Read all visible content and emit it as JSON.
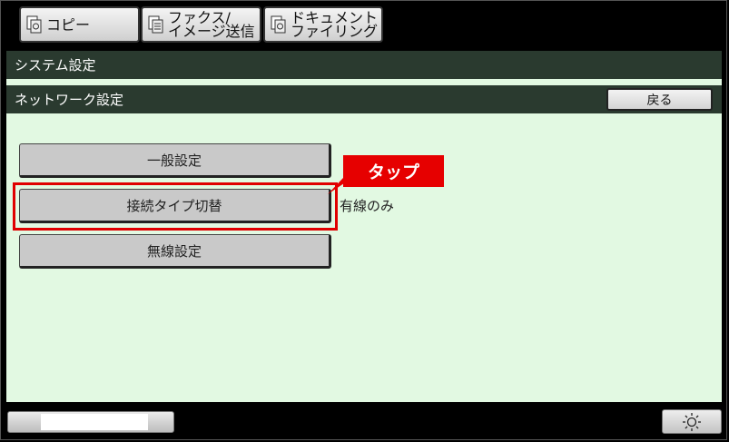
{
  "top_tabs": [
    {
      "label": "コピー"
    },
    {
      "label": "ファクス/\nイメージ送信"
    },
    {
      "label": "ドキュメント\nファイリング"
    }
  ],
  "header": {
    "system_settings": "システム設定",
    "network_settings": "ネットワーク設定",
    "back_label": "戻る"
  },
  "menu": {
    "general_settings": "一般設定",
    "connection_type_switch": "接続タイプ切替",
    "connection_type_value": "有線のみ",
    "wireless_settings": "無線設定"
  },
  "annotation": {
    "callout_text": "タップ",
    "color": "#e60000"
  },
  "bottom": {
    "settings_icon": "sun-brightness-icon"
  }
}
